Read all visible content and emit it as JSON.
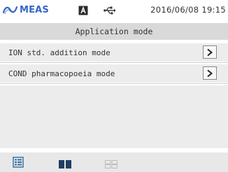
{
  "status_bar": {
    "meas_label": "MEAS",
    "meas_icon": "meas-wave-icon",
    "indicator_icon": "a-box-icon",
    "connection_icon": "usb-icon",
    "datetime": "2016/06/08 19:15"
  },
  "title": "Application mode",
  "menu": {
    "items": [
      {
        "label": "ION std. addition mode",
        "arrow": ">"
      },
      {
        "label": "COND pharmacopoeia mode",
        "arrow": ">"
      }
    ]
  },
  "bottom_bar": {
    "icons": [
      "list-view-icon",
      "split-view-icon",
      "grid-view-icon"
    ]
  },
  "colors": {
    "accent": "#3566c8",
    "title_bg": "#d9d9d9",
    "row_bg": "#ececec"
  }
}
